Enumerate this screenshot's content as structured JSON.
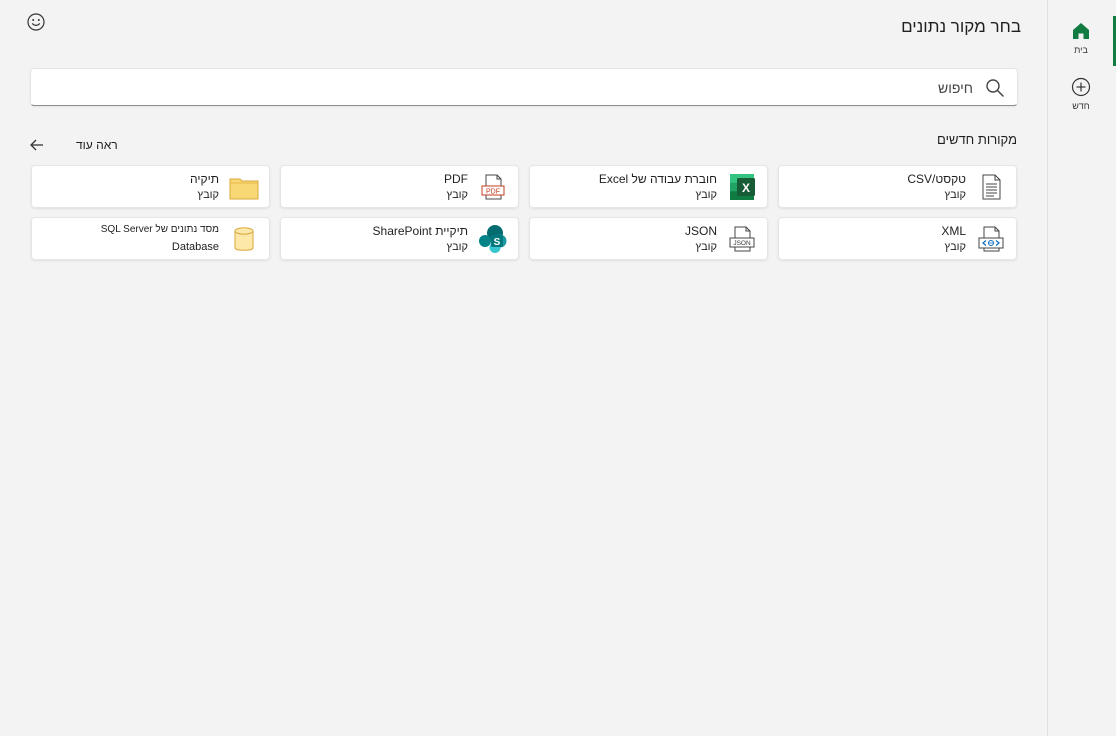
{
  "header": {
    "title": "בחר מקור נתונים"
  },
  "nav": {
    "items": [
      {
        "label": "בית",
        "icon": "home-icon",
        "active": true
      },
      {
        "label": "חדש",
        "icon": "add-circle-icon",
        "active": false
      }
    ]
  },
  "search": {
    "placeholder": "חיפוש"
  },
  "section": {
    "title": "מקורות חדשים",
    "see_more": "ראה עוד"
  },
  "cards": [
    {
      "title": "טקסט/CSV",
      "subtitle": "קובץ",
      "icon": "text-file-icon"
    },
    {
      "title": "חוברת עבודה של Excel",
      "subtitle": "קובץ",
      "icon": "excel-icon"
    },
    {
      "title": "PDF",
      "subtitle": "קובץ",
      "icon": "pdf-icon"
    },
    {
      "title": "תיקיה",
      "subtitle": "קובץ",
      "icon": "folder-icon"
    },
    {
      "title": "XML",
      "subtitle": "קובץ",
      "icon": "xml-file-icon"
    },
    {
      "title": "JSON",
      "subtitle": "קובץ",
      "icon": "json-file-icon"
    },
    {
      "title": "תיקיית SharePoint",
      "subtitle": "קובץ",
      "icon": "sharepoint-icon"
    },
    {
      "title": "מסד נתונים של SQL Server",
      "subtitle": "Database",
      "icon": "database-icon"
    }
  ],
  "colors": {
    "accent": "#107c41",
    "excel_green": "#107c41",
    "sharepoint_teal": "#036c70",
    "folder_yellow": "#f8d775"
  }
}
